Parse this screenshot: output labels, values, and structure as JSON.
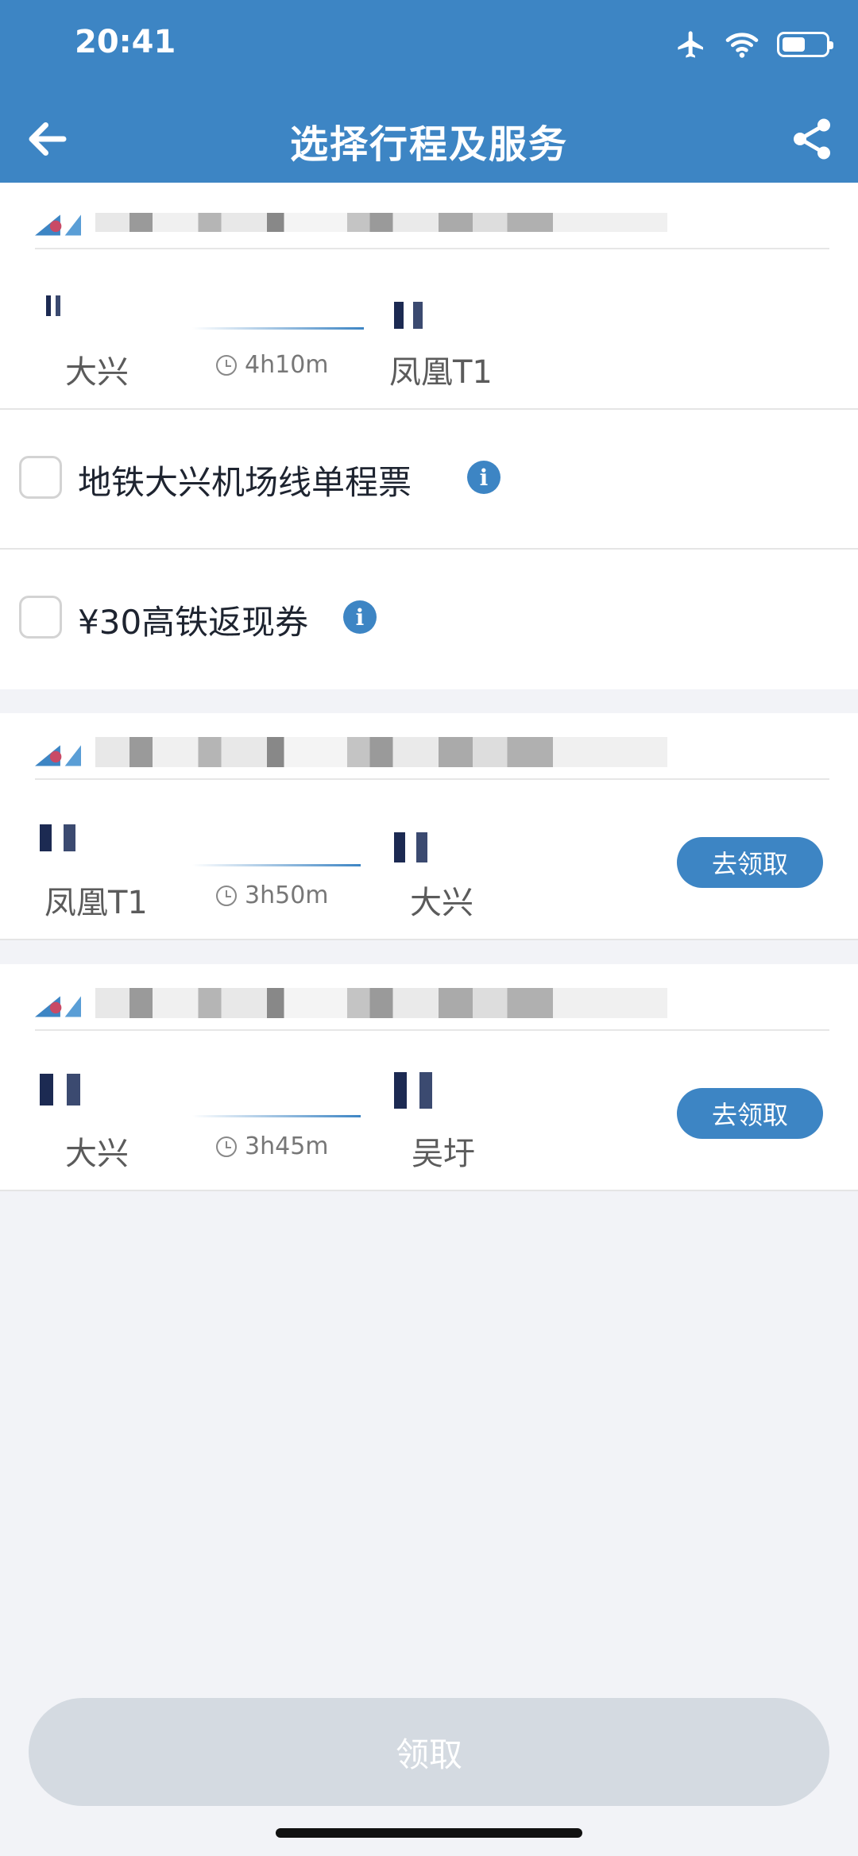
{
  "status": {
    "time": "20:41"
  },
  "nav": {
    "title": "选择行程及服务"
  },
  "trip1": {
    "from": "大兴",
    "duration": "4h10m",
    "to": "凤凰T1"
  },
  "options": [
    {
      "label": "地铁大兴机场线单程票",
      "checked": false
    },
    {
      "label": "¥30高铁返现券",
      "checked": false
    }
  ],
  "trip2": {
    "from": "凤凰T1",
    "duration": "3h50m",
    "to": "大兴",
    "button": "去领取"
  },
  "trip3": {
    "from": "大兴",
    "duration": "3h45m",
    "to": "吴圩",
    "button": "去领取"
  },
  "footer": {
    "claim": "领取"
  },
  "icons": [
    "airplane-mode-icon",
    "wifi-icon",
    "battery-icon",
    "back-arrow-icon",
    "share-icon",
    "airline-logo-icon",
    "clock-icon",
    "info-icon"
  ],
  "colors": {
    "primary": "#3d85c4",
    "background": "#f2f3f7",
    "disabled": "#d4dae1"
  }
}
